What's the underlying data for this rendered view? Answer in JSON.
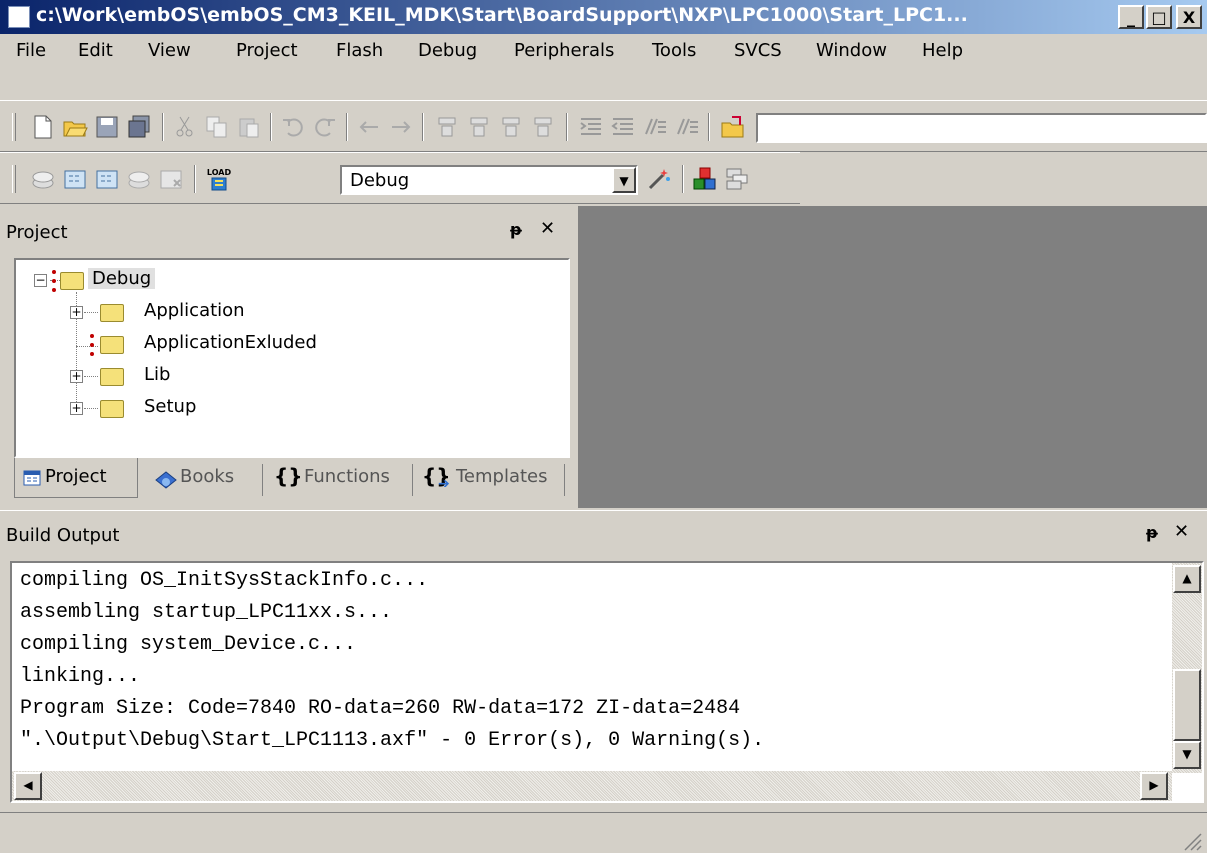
{
  "window": {
    "title": "c:\\Work\\embOS\\embOS_CM3_KEIL_MDK\\Start\\BoardSupport\\NXP\\LPC1000\\Start_LPC1...",
    "minimize": "_",
    "maximize": "□",
    "close": "X"
  },
  "menu": [
    "File",
    "Edit",
    "View",
    "Project",
    "Flash",
    "Debug",
    "Peripherals",
    "Tools",
    "SVCS",
    "Window",
    "Help"
  ],
  "toolbar2": {
    "target": "Debug",
    "load_label": "LOAD"
  },
  "project_panel": {
    "title": "Project",
    "pin": "ᵽ",
    "close": "✕",
    "root": "Debug",
    "items": [
      "Application",
      "ApplicationExluded",
      "Lib",
      "Setup"
    ],
    "tabs": [
      "Project",
      "Books",
      "Functions",
      "Templates"
    ],
    "tab_glyphs": {
      "functions": "{}",
      "templates": "{}"
    }
  },
  "build_panel": {
    "title": "Build Output",
    "pin": "ᵽ",
    "close": "✕",
    "lines": [
      "compiling OS_InitSysStackInfo.c...",
      "assembling startup_LPC11xx.s...",
      "compiling system_Device.c...",
      "linking...",
      "Program Size: Code=7840 RO-data=260 RW-data=172 ZI-data=2484",
      "\".\\Output\\Debug\\Start_LPC1113.axf\" - 0 Error(s), 0 Warning(s)."
    ]
  },
  "scroll_glyphs": {
    "up": "▲",
    "down": "▼",
    "left": "◀",
    "right": "▶"
  },
  "icons": [
    "new-file-icon",
    "open-folder-icon",
    "save-icon",
    "save-all-icon",
    "cut-icon",
    "copy-icon",
    "paste-icon",
    "undo-icon",
    "redo-icon",
    "navigate-back-icon",
    "navigate-forward-icon",
    "bookmark-icon",
    "indent-icon",
    "unindent-icon",
    "comment-icon",
    "uncomment-icon",
    "open-icon",
    "translate-icon",
    "build-icon",
    "rebuild-icon",
    "batch-build-icon",
    "stop-build-icon",
    "load-icon",
    "options-wand-icon",
    "manage-components-icon",
    "file-extensions-icon"
  ],
  "colors": {
    "titlebar": "#0a246a",
    "face": "#d4d0c8",
    "workspace": "#808080"
  }
}
